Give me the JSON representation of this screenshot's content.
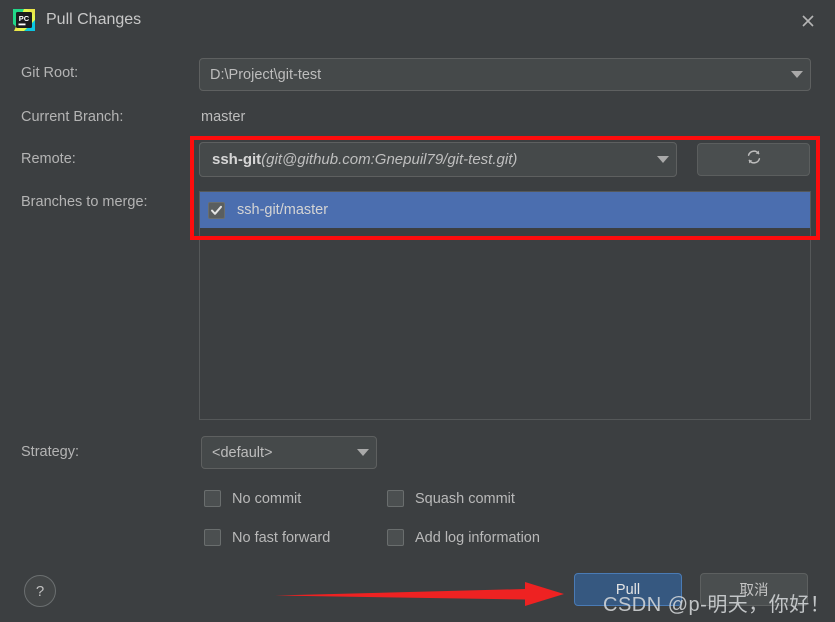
{
  "window": {
    "title": "Pull Changes",
    "app_icon": "pycharm-logo-icon",
    "close_icon": "close-icon"
  },
  "form": {
    "git_root": {
      "label": "Git Root:",
      "value": "D:\\Project\\git-test"
    },
    "current_branch": {
      "label": "Current Branch:",
      "value": "master"
    },
    "remote": {
      "label": "Remote:",
      "name": "ssh-git",
      "url": "(git@github.com:Gnepuil79/git-test.git)",
      "refresh_icon": "refresh-icon"
    },
    "branches_to_merge": {
      "label": "Branches to merge:",
      "items": [
        {
          "label": "ssh-git/master",
          "checked": true,
          "selected": true
        }
      ]
    },
    "strategy": {
      "label": "Strategy:",
      "value": "<default>"
    },
    "options": [
      {
        "label": "No commit",
        "checked": false
      },
      {
        "label": "Squash commit",
        "checked": false
      },
      {
        "label": "No fast forward",
        "checked": false
      },
      {
        "label": "Add log information",
        "checked": false
      }
    ]
  },
  "footer": {
    "help_label": "?",
    "pull_label": "Pull",
    "cancel_label": "取消"
  },
  "annotations": {
    "highlight_color": "#fd0d0d",
    "arrow_color": "#ee2222",
    "watermark": "CSDN @p-明天，你好！"
  },
  "colors": {
    "dialog_background": "#3c3f41",
    "selection_blue": "#4b6eaf",
    "default_button_blue": "#365880",
    "field_background": "#45494a"
  }
}
